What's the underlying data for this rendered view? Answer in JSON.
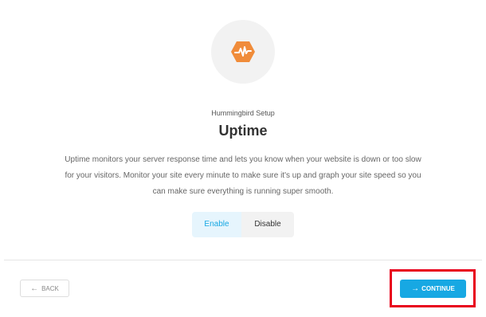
{
  "header": {
    "icon": "uptime-pulse-icon",
    "subtitle": "Hummingbird Setup",
    "title": "Uptime",
    "description": "Uptime monitors your server response time and lets you know when your website is down or too slow for your visitors. Monitor your site every minute to make sure it's up and graph your site speed so you can make sure everything is running super smooth."
  },
  "toggle": {
    "options": [
      {
        "label": "Enable",
        "selected": true
      },
      {
        "label": "Disable",
        "selected": false
      }
    ]
  },
  "footer": {
    "back_label": "BACK",
    "back_icon": "arrow-left-icon",
    "continue_label": "CONTINUE",
    "continue_icon": "arrow-right-icon"
  },
  "colors": {
    "accent": "#17a8e3",
    "brand_orange": "#f08c3a",
    "highlight_red": "#e8001c"
  }
}
